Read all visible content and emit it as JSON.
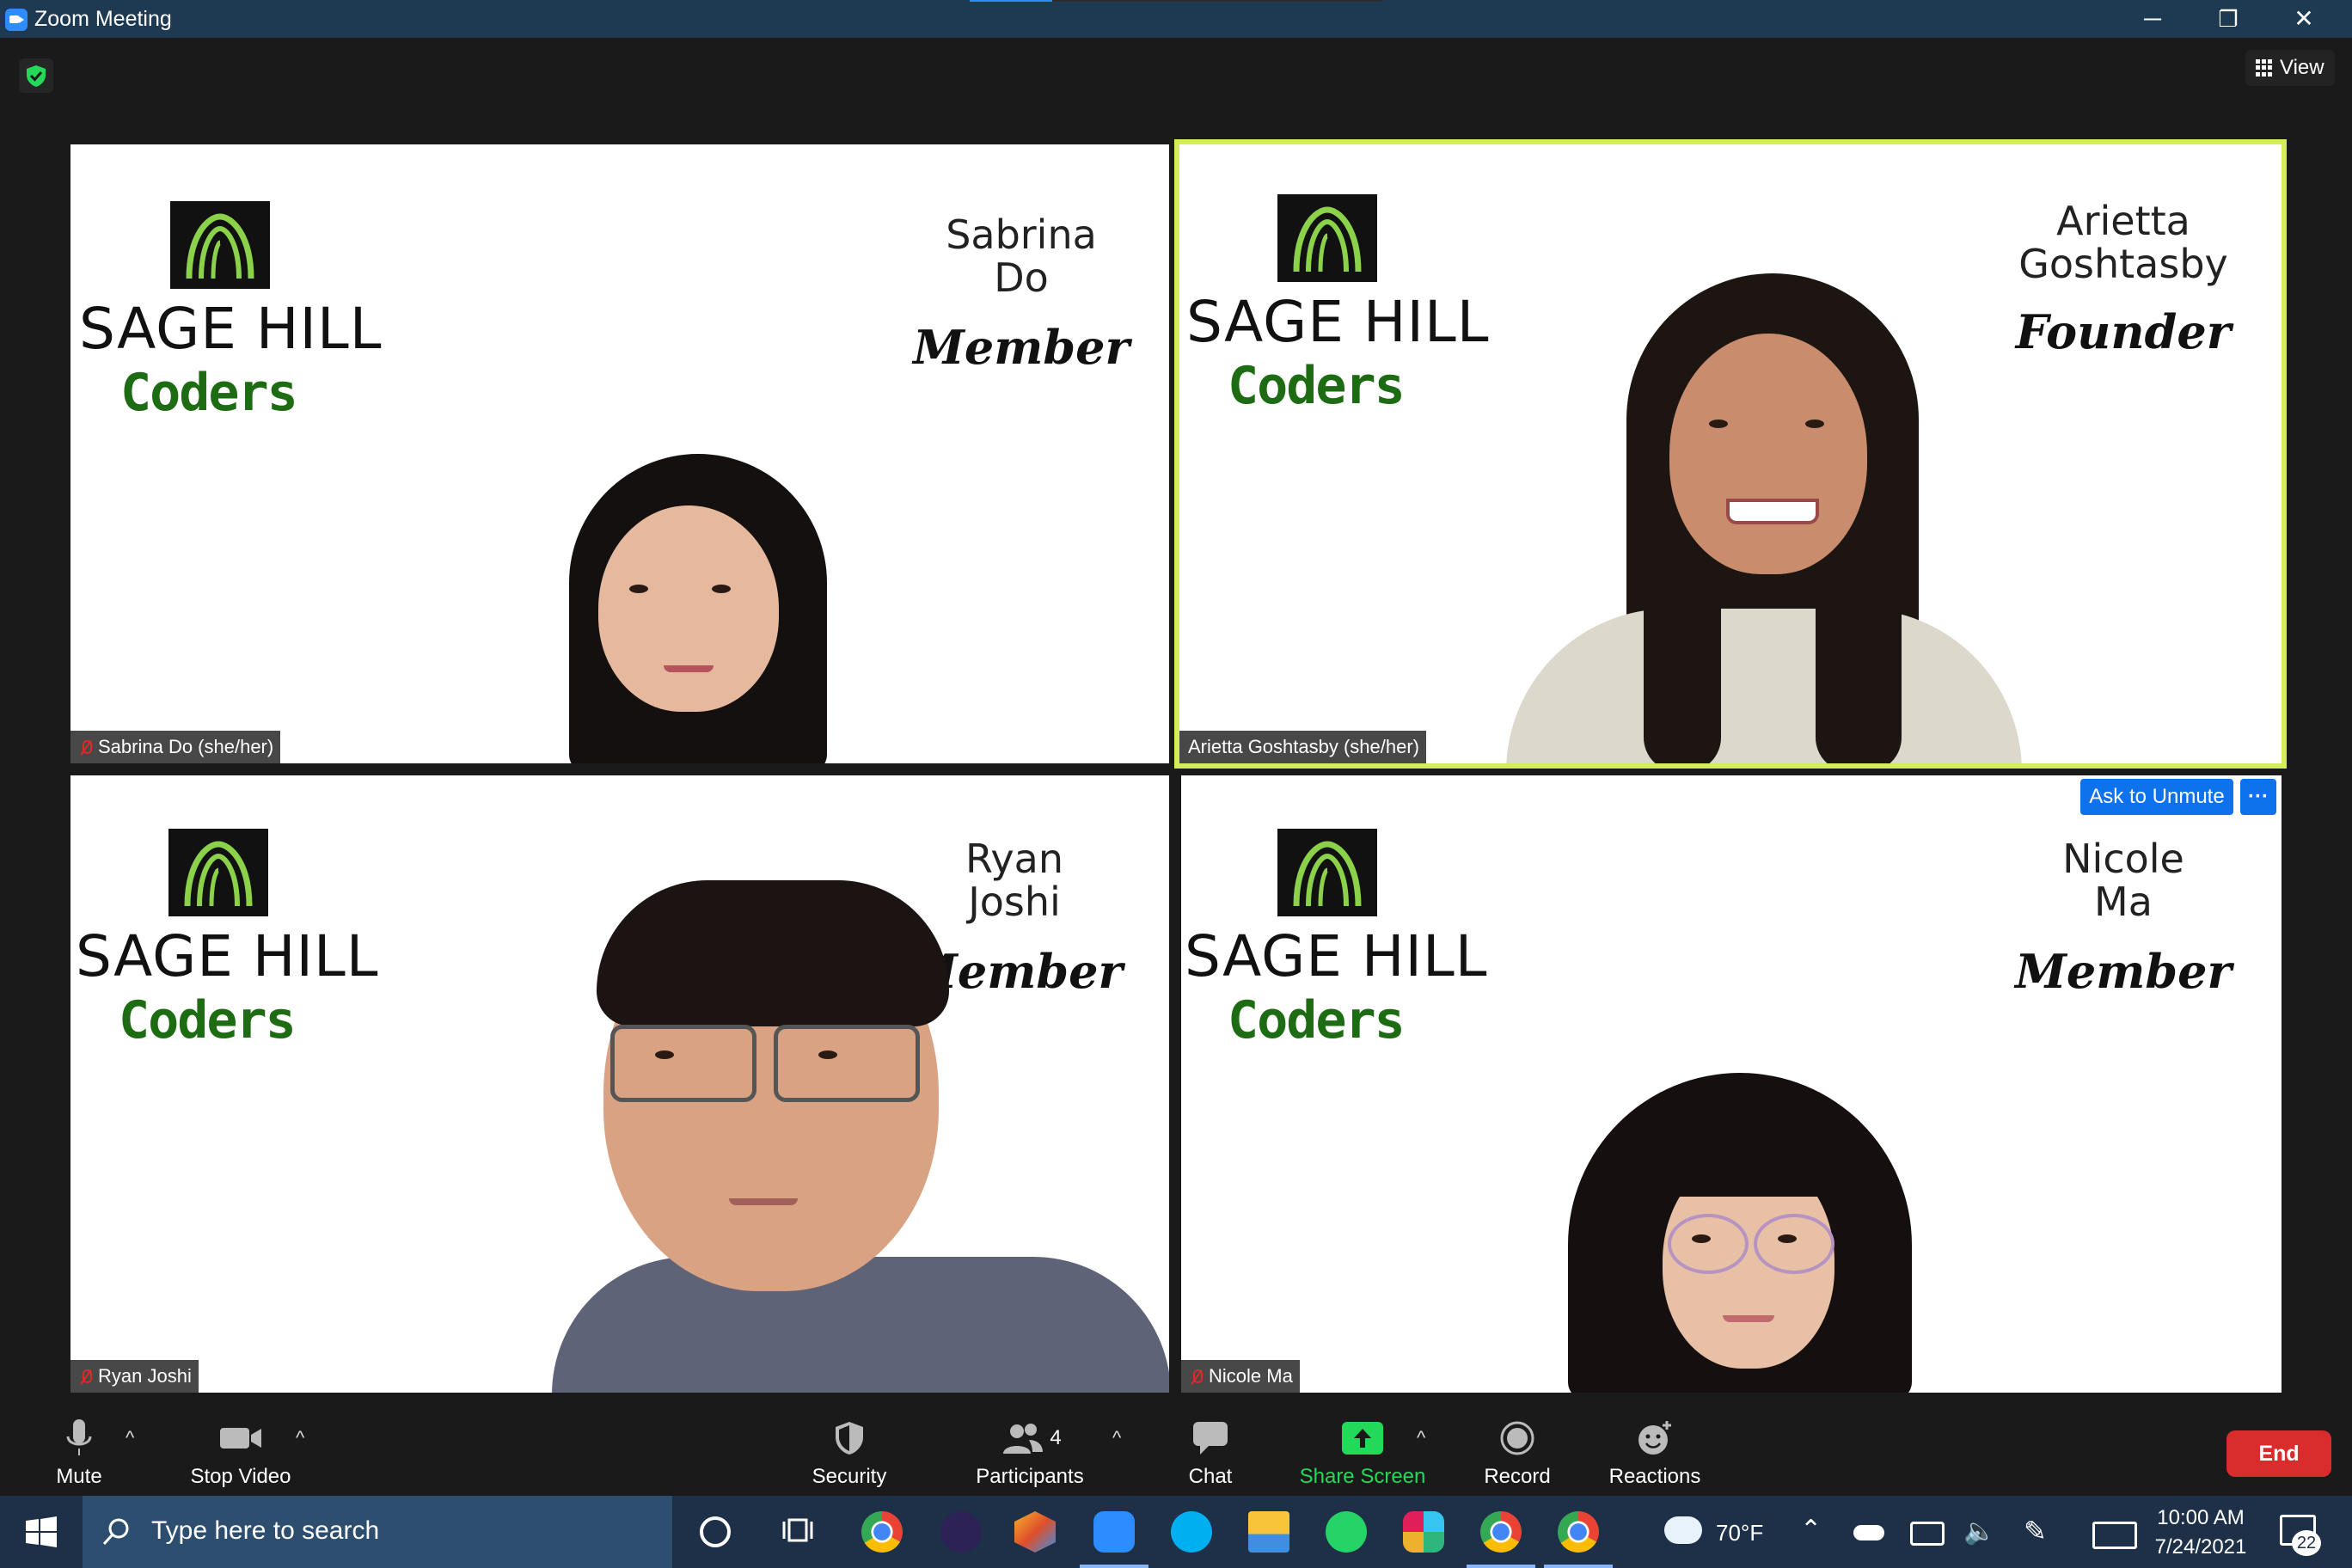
{
  "window": {
    "title": "Zoom Meeting",
    "controls": {
      "minimize": "─",
      "restore": "❐",
      "close": "✕"
    }
  },
  "header": {
    "view_label": "View",
    "security_color": "#23d959"
  },
  "tiles": [
    {
      "display_name": "Sabrina Do (she/her)",
      "card_first": "Sabrina",
      "card_last": "Do",
      "role": "Member",
      "muted": true,
      "active": false
    },
    {
      "display_name": "Arietta Goshtasby (she/her)",
      "card_first": "Arietta",
      "card_last": "Goshtasby",
      "role": "Founder",
      "muted": false,
      "active": true
    },
    {
      "display_name": "Ryan Joshi",
      "card_first": "Ryan",
      "card_last": "Joshi",
      "role": "Member",
      "muted": true,
      "active": false
    },
    {
      "display_name": "Nicole Ma",
      "card_first": "Nicole",
      "card_last": "Ma",
      "role": "Member",
      "muted": true,
      "active": false
    }
  ],
  "branding": {
    "line1": "SAGE HILL",
    "line2": "Coders"
  },
  "ask_to_unmute": {
    "label": "Ask to Unmute",
    "more": "···"
  },
  "toolbar": {
    "mute": "Mute",
    "stop_video": "Stop Video",
    "security": "Security",
    "participants": "Participants",
    "participants_count": "4",
    "chat": "Chat",
    "share_screen": "Share Screen",
    "record": "Record",
    "reactions": "Reactions",
    "end": "End",
    "caret": "^",
    "accent_green": "#23d959",
    "end_color": "#d92d2d"
  },
  "taskbar": {
    "search_placeholder": "Type here to search",
    "weather": "70°F",
    "time": "10:00 AM",
    "date": "7/24/2021",
    "notifications": "22"
  }
}
